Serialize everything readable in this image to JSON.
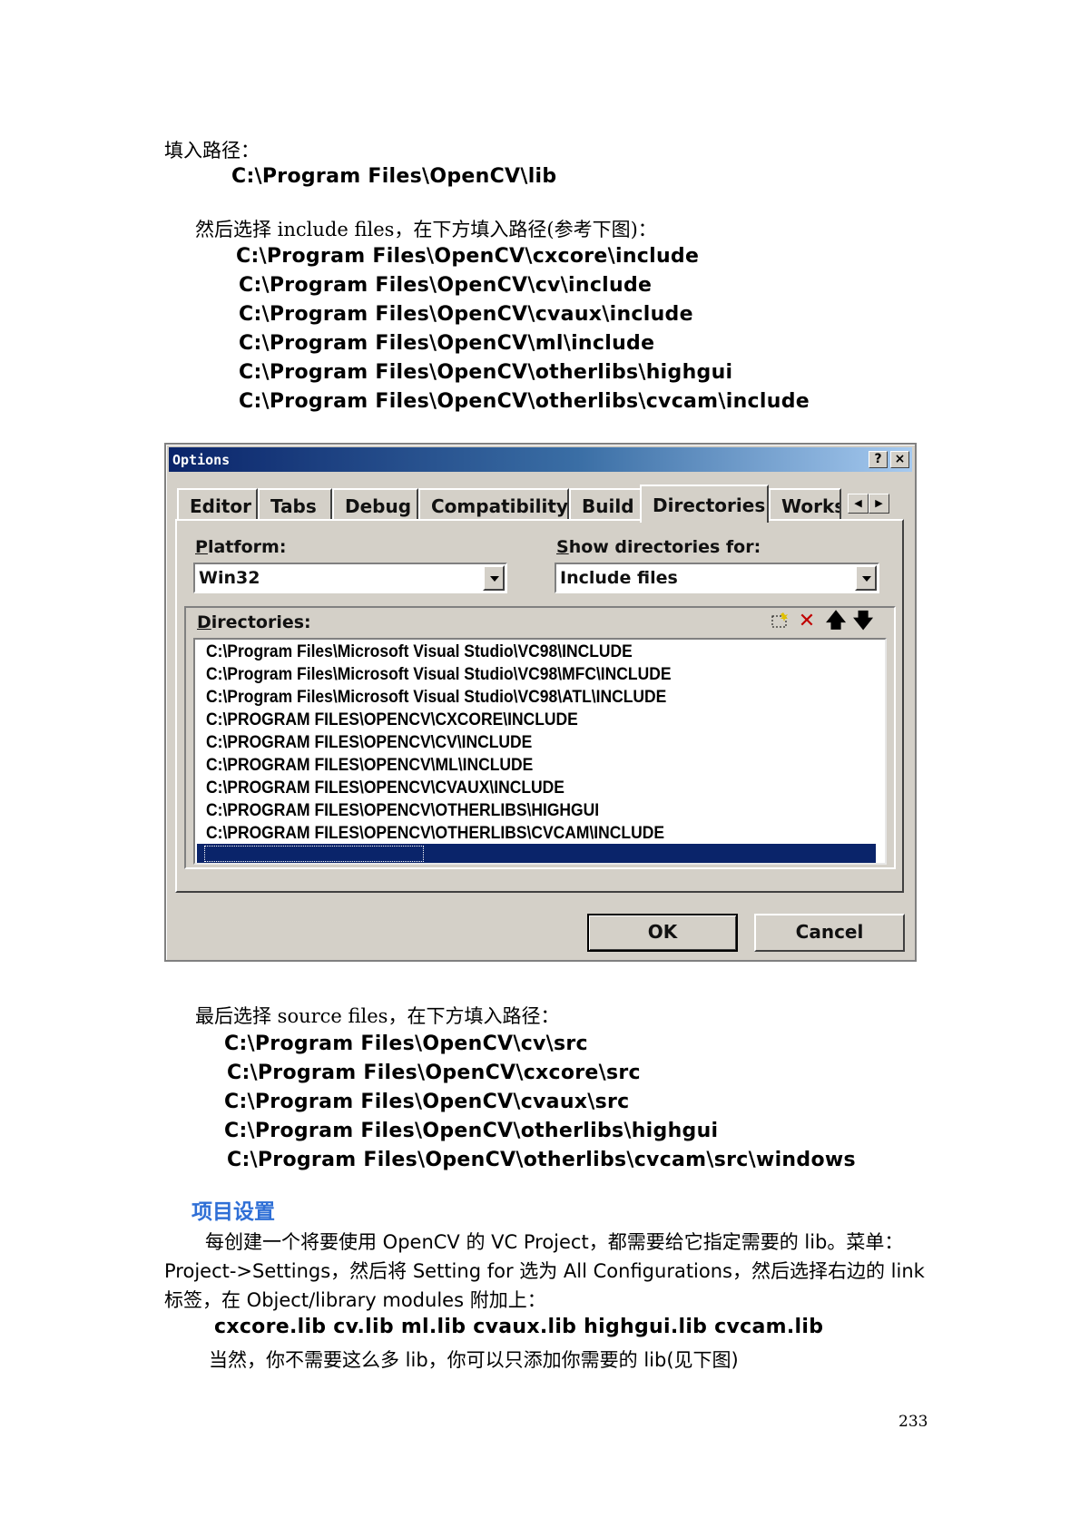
{
  "text": {
    "intro_label": "填入路径：",
    "lib_path": "C:\\Program Files\\OpenCV\\lib",
    "include_intro": "然后选择 include files，在下方填入路径(参考下图)：",
    "include_paths": [
      "C:\\Program Files\\OpenCV\\cxcore\\include",
      "C:\\Program Files\\OpenCV\\cv\\include",
      "C:\\Program Files\\OpenCV\\cvaux\\include",
      "C:\\Program Files\\OpenCV\\ml\\include",
      "C:\\Program Files\\OpenCV\\otherlibs\\highgui",
      "C:\\Program Files\\OpenCV\\otherlibs\\cvcam\\include"
    ],
    "source_intro": "最后选择 source files，在下方填入路径：",
    "source_paths": [
      "C:\\Program Files\\OpenCV\\cv\\src",
      "C:\\Program Files\\OpenCV\\cxcore\\src",
      "C:\\Program Files\\OpenCV\\cvaux\\src",
      "C:\\Program Files\\OpenCV\\otherlibs\\highgui",
      "C:\\Program Files\\OpenCV\\otherlibs\\cvcam\\src\\windows"
    ],
    "section_heading": "项目设置",
    "para_line1": "每创建一个将要使用 OpenCV 的 VC Project，都需要给它指定需要的 lib。菜单：",
    "para_line2": "Project->Settings，然后将 Setting for 选为 All Configurations，然后选择右边的 link",
    "para_line3": "标签，在 Object/library modules 附加上：",
    "libs_line": "cxcore.lib cv.lib ml.lib cvaux.lib highgui.lib cvcam.lib",
    "closing_line": "当然，你不需要这么多 lib，你可以只添加你需要的 lib(见下图)",
    "page_number": "233"
  },
  "dialog": {
    "title": "Options",
    "help_btn": "?",
    "close_btn": "×",
    "tabs": [
      "Editor",
      "Tabs",
      "Debug",
      "Compatibility",
      "Build",
      "Directories",
      "Works"
    ],
    "active_tab": "Directories",
    "platform_label_first": "P",
    "platform_label_rest": "latform:",
    "platform_value": "Win32",
    "show_dirs_label_first": "S",
    "show_dirs_label_rest": "how directories for:",
    "show_dirs_value": "Include files",
    "directories_label_first": "D",
    "directories_label_rest": "irectories:",
    "directory_list": [
      "C:\\Program Files\\Microsoft Visual Studio\\VC98\\INCLUDE",
      "C:\\Program Files\\Microsoft Visual Studio\\VC98\\MFC\\INCLUDE",
      "C:\\Program Files\\Microsoft Visual Studio\\VC98\\ATL\\INCLUDE",
      "C:\\PROGRAM FILES\\OPENCV\\CXCORE\\INCLUDE",
      "C:\\PROGRAM FILES\\OPENCV\\CV\\INCLUDE",
      "C:\\PROGRAM FILES\\OPENCV\\ML\\INCLUDE",
      "C:\\PROGRAM FILES\\OPENCV\\CVAUX\\INCLUDE",
      "C:\\PROGRAM FILES\\OPENCV\\OTHERLIBS\\HIGHGUI",
      "C:\\PROGRAM FILES\\OPENCV\\OTHERLIBS\\CVCAM\\INCLUDE"
    ],
    "ok_label": "OK",
    "cancel_label": "Cancel",
    "icons": [
      "new-folder-icon",
      "delete-icon",
      "move-up-icon",
      "move-down-icon",
      "tab-scroll-left-icon",
      "tab-scroll-right-icon"
    ],
    "colors": {
      "titlebar_start": "#0a246a",
      "titlebar_end": "#a6caf0",
      "face": "#d4d0c8",
      "selection": "#0a246a"
    }
  },
  "colors": {
    "heading": "#2f6fd6"
  }
}
